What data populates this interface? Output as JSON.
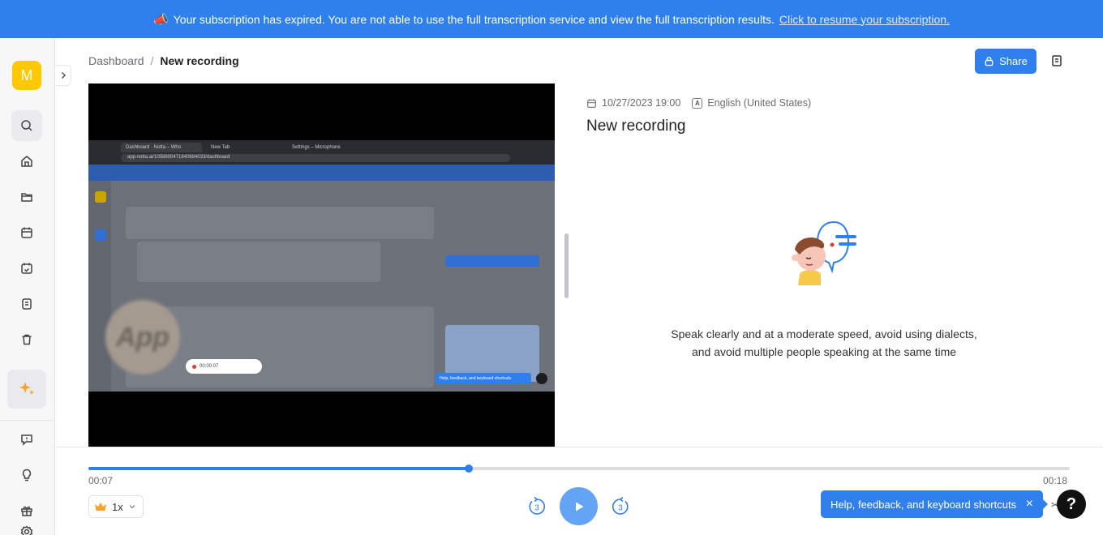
{
  "banner": {
    "emoji": "📣",
    "message": "Your subscription has expired. You are not able to use the full transcription service and view the full transcription results.",
    "link": "Click to resume your subscription."
  },
  "sidebar": {
    "avatar_letter": "M",
    "icons": [
      "search-icon",
      "home-icon",
      "folder-icon",
      "calendar-icon",
      "calendar-check-icon",
      "notes-icon",
      "trash-icon",
      "sparkle-icon",
      "feedback-icon",
      "bulb-icon",
      "gift-icon",
      "settings-icon"
    ]
  },
  "header": {
    "breadcrumb_root": "Dashboard",
    "breadcrumb_sep": "/",
    "breadcrumb_current": "New recording",
    "share_label": "Share"
  },
  "video": {
    "tabs": [
      "Dashboard · Notta – Who",
      "New Tab",
      "Settings – Microphone"
    ],
    "url": "app.notta.ai/1058800471840684033/dashboard",
    "recording_timer": "00:00:07",
    "mini_help": "Help, feedback, and keyboard shortcuts",
    "logo_text": "App"
  },
  "recording": {
    "datetime": "10/27/2023 19:00",
    "lang_badge": "A",
    "language": "English (United States)",
    "title": "New recording",
    "tip": "Speak clearly and at a moderate speed, avoid using dialects, and avoid multiple people speaking at the same time"
  },
  "player": {
    "current_time": "00:07",
    "total_time": "00:18",
    "progress_percent": 38.8,
    "speed_label": "1x",
    "speed_icon": "crown-icon",
    "skip_back_seconds": "3",
    "skip_forward_seconds": "3"
  },
  "help": {
    "tooltip": "Help, feedback, and keyboard shortcuts",
    "close": "×",
    "button": "?"
  },
  "colors": {
    "accent": "#2f80ed",
    "avatar": "#ffc800",
    "play": "#63a4f4"
  }
}
